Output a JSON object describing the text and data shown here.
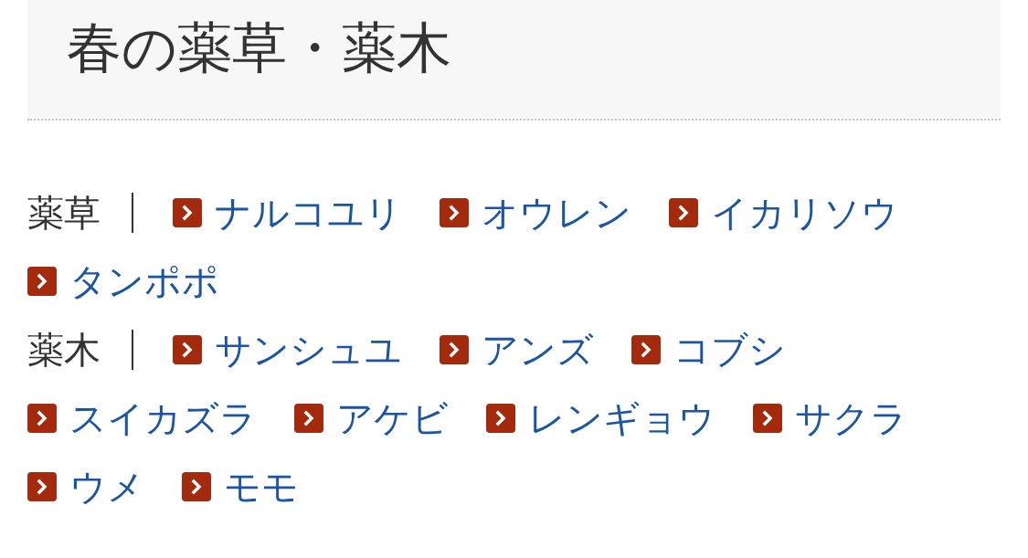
{
  "heading": {
    "title": "春の薬草・薬木"
  },
  "categories": [
    {
      "label": "薬草",
      "items": [
        "ナルコユリ",
        "オウレン",
        "イカリソウ",
        "タンポポ"
      ]
    },
    {
      "label": "薬木",
      "items": [
        "サンシュユ",
        "アンズ",
        "コブシ",
        "スイカズラ",
        "アケビ",
        "レンギョウ",
        "サクラ",
        "ウメ",
        "モモ"
      ]
    }
  ]
}
